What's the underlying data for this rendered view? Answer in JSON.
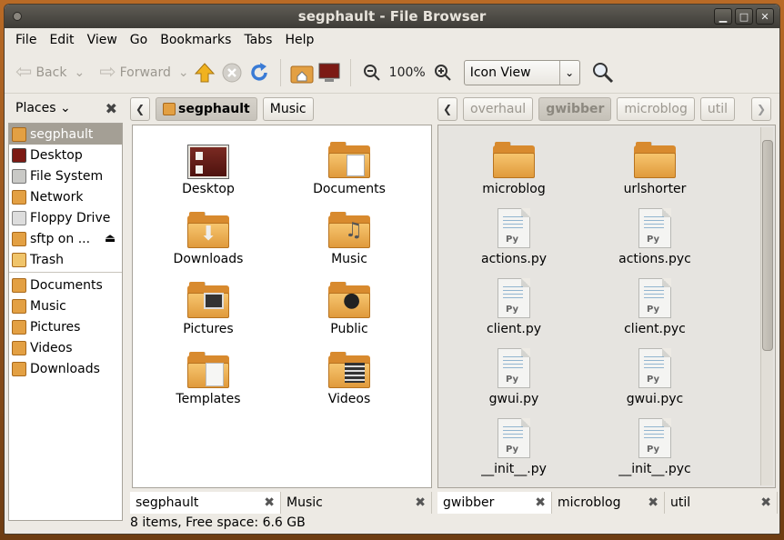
{
  "window": {
    "title": "segphault - File Browser"
  },
  "menubar": [
    "File",
    "Edit",
    "View",
    "Go",
    "Bookmarks",
    "Tabs",
    "Help"
  ],
  "toolbar": {
    "back": "Back",
    "forward": "Forward",
    "zoom": "100%",
    "view_mode": "Icon View"
  },
  "sidebar": {
    "title": "Places",
    "items": [
      {
        "label": "segphault",
        "icon": "home-folder-icon",
        "selected": true
      },
      {
        "label": "Desktop",
        "icon": "desktop-icon"
      },
      {
        "label": "File System",
        "icon": "drive-icon"
      },
      {
        "label": "Network",
        "icon": "network-icon"
      },
      {
        "label": "Floppy Drive",
        "icon": "floppy-icon"
      },
      {
        "label": "sftp on ...",
        "icon": "network-share-icon"
      },
      {
        "label": "Trash",
        "icon": "trash-icon"
      }
    ],
    "bookmarks": [
      {
        "label": "Documents",
        "icon": "documents-folder-icon"
      },
      {
        "label": "Music",
        "icon": "music-folder-icon"
      },
      {
        "label": "Pictures",
        "icon": "pictures-folder-icon"
      },
      {
        "label": "Videos",
        "icon": "videos-folder-icon"
      },
      {
        "label": "Downloads",
        "icon": "downloads-folder-icon"
      }
    ]
  },
  "left_pane": {
    "path": [
      "segphault",
      "Music"
    ],
    "items": [
      "Desktop",
      "Documents",
      "Downloads",
      "Music",
      "Pictures",
      "Public",
      "Templates",
      "Videos"
    ],
    "tabs": [
      "segphault",
      "Music"
    ]
  },
  "right_pane": {
    "path": [
      "overhaul",
      "gwibber",
      "microblog",
      "util"
    ],
    "items": [
      "microblog",
      "urlshorter",
      "actions.py",
      "actions.pyc",
      "client.py",
      "client.pyc",
      "gwui.py",
      "gwui.pyc",
      "__init__.py",
      "__init__.pyc"
    ],
    "tabs": [
      "gwibber",
      "microblog",
      "util"
    ]
  },
  "status": "8 items, Free space: 6.6 GB"
}
